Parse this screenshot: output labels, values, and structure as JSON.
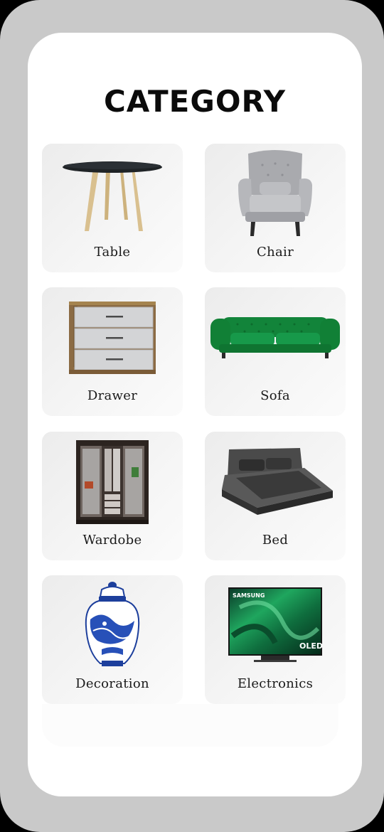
{
  "header": {
    "title": "CATEGORY"
  },
  "categories": [
    {
      "label": "Table",
      "icon": "table-icon"
    },
    {
      "label": "Chair",
      "icon": "armchair-icon"
    },
    {
      "label": "Drawer",
      "icon": "drawer-icon"
    },
    {
      "label": "Sofa",
      "icon": "sofa-icon"
    },
    {
      "label": "Wardobe",
      "icon": "wardrobe-icon"
    },
    {
      "label": "Bed",
      "icon": "bed-icon"
    },
    {
      "label": "Decoration",
      "icon": "vase-icon"
    },
    {
      "label": "Electronics",
      "icon": "tv-icon"
    }
  ],
  "tv": {
    "brand": "SAMSUNG",
    "badge": "OLED"
  },
  "colors": {
    "frame": "#c9c9c9",
    "screen": "#ffffff",
    "card": "#f3f3f3",
    "sofa_green": "#12843a"
  }
}
